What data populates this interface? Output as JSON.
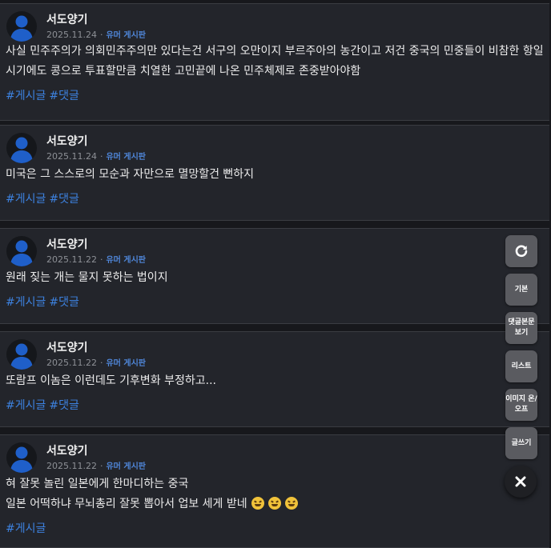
{
  "posts": [
    {
      "author": "서도양기",
      "date": "2025.11.24",
      "separator": "·",
      "board": "유머 게시판",
      "lines": [
        "사실 민주주의가 의회민주주의만 있다는건 서구의 오만이지 부르주아의 농간이고 저건 중국의 민중들이 비참한 항일시기에도 콩으로 투표할만큼 치열한 고민끝에 나온 민주체제로 존중받아야함"
      ],
      "tags": [
        "#게시글",
        "#댓글"
      ]
    },
    {
      "author": "서도양기",
      "date": "2025.11.24",
      "separator": "·",
      "board": "유머 게시판",
      "lines": [
        "미국은 그 스스로의 모순과 자만으로 멸망할건 뻔하지"
      ],
      "tags": [
        "#게시글",
        "#댓글"
      ]
    },
    {
      "author": "서도양기",
      "date": "2025.11.22",
      "separator": "·",
      "board": "유머 게시판",
      "lines": [
        "원래 짖는 개는 물지 못하는 법이지"
      ],
      "tags": [
        "#게시글",
        "#댓글"
      ]
    },
    {
      "author": "서도양기",
      "date": "2025.11.22",
      "separator": "·",
      "board": "유머 게시판",
      "lines": [
        "또람프 이놈은 이런데도 기후변화 부정하고..."
      ],
      "tags": [
        "#게시글",
        "#댓글"
      ]
    },
    {
      "author": "서도양기",
      "date": "2025.11.22",
      "separator": "·",
      "board": "유머 게시판",
      "lines": [
        "혀 잘못 놀린 일본에게 한마디하는 중국",
        "일본 어떡하냐 무뇌총리 잘못 뽑아서 업보 세게 받네"
      ],
      "tags": [
        "#게시글"
      ]
    }
  ],
  "emoji_icons": [
    "grinning-squint-icon",
    "grinning-squint-icon",
    "grinning-squint-icon"
  ],
  "side_menu": {
    "refresh_icon": "refresh-icon",
    "basic": "기본",
    "view_comment_body": "댓글본문\n보기",
    "list": "리스트",
    "image_toggle": "이미지 온/\n오프",
    "write": "글쓰기",
    "close_icon": "close-icon"
  },
  "colors": {
    "background": "#17181c",
    "card": "#23252b",
    "accent": "#3d82e0",
    "avatar": "#1f5fc9",
    "button": "#5a5b60"
  }
}
